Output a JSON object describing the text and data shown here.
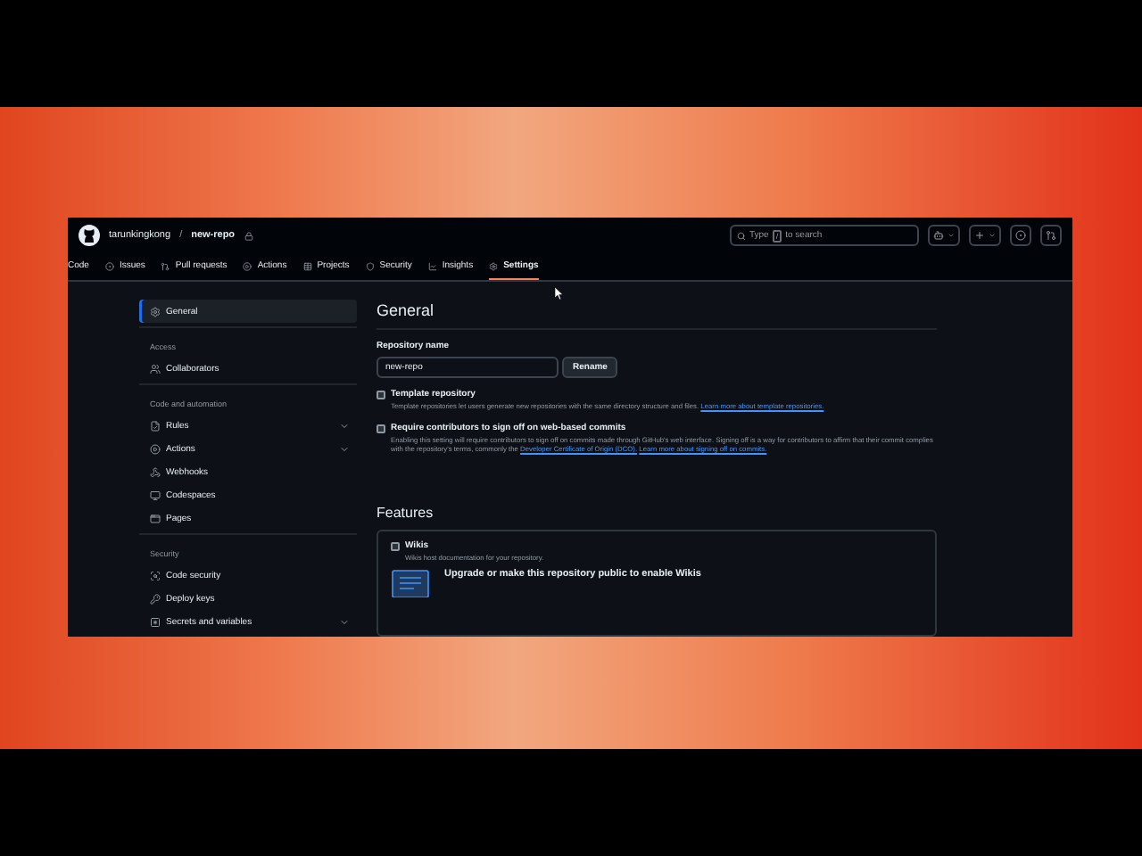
{
  "header": {
    "owner": "tarunkingkong",
    "separator": "/",
    "repo": "new-repo",
    "search": {
      "placeholder_before": "Type",
      "key": "/",
      "placeholder_after": "to search"
    }
  },
  "tabs": [
    {
      "label": "Code",
      "selected": false
    },
    {
      "label": "Issues",
      "selected": false
    },
    {
      "label": "Pull requests",
      "selected": false
    },
    {
      "label": "Actions",
      "selected": false
    },
    {
      "label": "Projects",
      "selected": false
    },
    {
      "label": "Security",
      "selected": false
    },
    {
      "label": "Insights",
      "selected": false
    },
    {
      "label": "Settings",
      "selected": true
    }
  ],
  "sidebar": {
    "groups": [
      {
        "items": [
          {
            "label": "General",
            "selected": true,
            "expandable": false
          }
        ]
      },
      {
        "heading": "Access",
        "items": [
          {
            "label": "Collaborators",
            "selected": false,
            "expandable": false
          }
        ]
      },
      {
        "heading": "Code and automation",
        "items": [
          {
            "label": "Rules",
            "selected": false,
            "expandable": true
          },
          {
            "label": "Actions",
            "selected": false,
            "expandable": true
          },
          {
            "label": "Webhooks",
            "selected": false,
            "expandable": false
          },
          {
            "label": "Codespaces",
            "selected": false,
            "expandable": false
          },
          {
            "label": "Pages",
            "selected": false,
            "expandable": false
          }
        ]
      },
      {
        "heading": "Security",
        "items": [
          {
            "label": "Code security",
            "selected": false,
            "expandable": false
          },
          {
            "label": "Deploy keys",
            "selected": false,
            "expandable": false
          },
          {
            "label": "Secrets and variables",
            "selected": false,
            "expandable": true
          }
        ]
      }
    ]
  },
  "main": {
    "title": "General",
    "repo_name_label": "Repository name",
    "repo_name_value": "new-repo",
    "rename_button": "Rename",
    "options": [
      {
        "label": "Template repository",
        "checked": false,
        "description": [
          {
            "kind": "text",
            "text": "Template repositories let users generate new repositories with the same directory structure and files."
          },
          {
            "kind": "link",
            "text": "Learn more about template repositories."
          }
        ]
      },
      {
        "label": "Require contributors to sign off on web-based commits",
        "checked": false,
        "description": [
          {
            "kind": "text",
            "text": "Enabling this setting will require contributors to sign off on commits made through GitHub's web interface. Signing off is a way for contributors to affirm that their commit complies with the repository's terms, commonly the"
          },
          {
            "kind": "link",
            "text": "Developer Certificate of Origin (DCO)."
          },
          {
            "kind": "link",
            "text": "Learn more about signing off on commits."
          }
        ]
      }
    ],
    "features_title": "Features",
    "features": [
      {
        "label": "Wikis",
        "checked": false,
        "description": "Wikis host documentation for your repository.",
        "upgrade": "Upgrade or make this repository public to enable Wikis"
      }
    ]
  }
}
